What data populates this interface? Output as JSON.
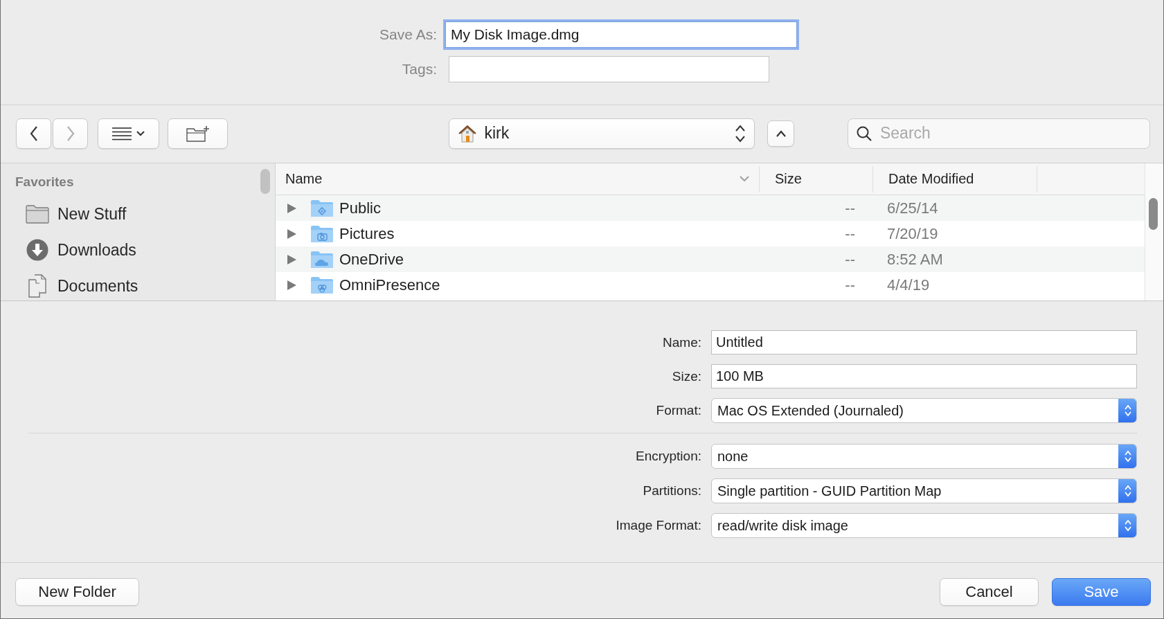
{
  "save_as": {
    "label": "Save As:",
    "value": "My Disk Image.dmg",
    "focused": true
  },
  "tags": {
    "label": "Tags:"
  },
  "toolbar": {
    "location": "kirk",
    "search": {
      "placeholder": "Search"
    },
    "back_enabled": true,
    "forward_enabled": false
  },
  "sidebar": {
    "section": "Favorites",
    "items": [
      {
        "label": "New Stuff",
        "kind": "folder"
      },
      {
        "label": "Downloads",
        "kind": "downloads"
      },
      {
        "label": "Documents",
        "kind": "documents"
      }
    ]
  },
  "file_list": {
    "columns": [
      "Name",
      "Size",
      "Date Modified"
    ],
    "rows": [
      {
        "name": "Public",
        "kind": "public",
        "size": "--",
        "date": "6/25/14"
      },
      {
        "name": "Pictures",
        "kind": "camera",
        "size": "--",
        "date": "7/20/19"
      },
      {
        "name": "OneDrive",
        "kind": "cloud",
        "size": "--",
        "date": "8:52 AM"
      },
      {
        "name": "OmniPresence",
        "kind": "sync",
        "size": "--",
        "date": "4/4/19"
      }
    ]
  },
  "form_groups": [
    [
      {
        "label": "Name:",
        "kind": "text",
        "value": "Untitled"
      },
      {
        "label": "Size:",
        "kind": "text",
        "value": "100 MB"
      },
      {
        "label": "Format:",
        "kind": "popup",
        "value": "Mac OS Extended (Journaled)"
      }
    ],
    [
      {
        "label": "Encryption:",
        "kind": "popup",
        "value": "none"
      },
      {
        "label": "Partitions:",
        "kind": "popup",
        "value": "Single partition - GUID Partition Map"
      },
      {
        "label": "Image Format:",
        "kind": "popup",
        "value": "read/write disk image"
      }
    ]
  ],
  "footer": {
    "left_buttons": [
      {
        "label": "New Folder",
        "default": false
      }
    ],
    "right_buttons": [
      {
        "label": "Cancel",
        "default": false
      },
      {
        "label": "Save",
        "default": true
      }
    ]
  }
}
